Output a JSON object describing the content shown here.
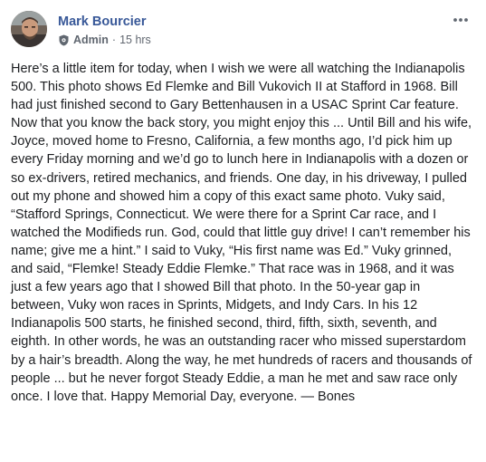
{
  "post": {
    "author_name": "Mark Bourcier",
    "role_label": "Admin",
    "separator": "·",
    "timestamp": "15 hrs",
    "body": "Here’s a little item for today, when I wish we were all watching the Indianapolis 500. This photo shows Ed Flemke and Bill Vukovich II at Stafford in 1968. Bill had just finished second to Gary Bettenhausen in a USAC Sprint Car feature. Now that you know the back story, you might enjoy this ... Until Bill and his wife, Joyce, moved home to Fresno, California, a few months ago, I’d pick him up every Friday morning and we’d go to lunch here in Indianapolis with a dozen or so ex-drivers, retired mechanics, and friends. One day, in his driveway, I pulled out my phone and showed him a copy of this exact same photo. Vuky said, “Stafford Springs, Connecticut. We were there for a Sprint Car race, and I watched the Modifieds run. God, could that little guy drive! I can’t remember his name; give me a hint.” I said to Vuky, “His first name was Ed.” Vuky grinned, and said, “Flemke! Steady Eddie Flemke.” That race was in 1968, and it was just a few years ago that I showed Bill that photo. In the 50-year gap in between, Vuky won races in Sprints, Midgets, and Indy Cars. In his 12 Indianapolis 500 starts, he finished second, third, fifth, sixth, seventh, and eighth. In other words, he was an outstanding racer who missed superstardom by a hair’s breadth. Along the way, he met hundreds of racers and thousands of people ... but he never forgot Steady Eddie, a man he met and saw race only once. I love that. Happy Memorial Day, everyone. — Bones"
  },
  "icons": {
    "avatar": "profile-photo",
    "admin": "shield-gear-icon",
    "more": "more-options-icon"
  },
  "colors": {
    "author_link": "#385898",
    "body_text": "#1c1e21",
    "meta_text": "#616770",
    "background": "#ffffff"
  }
}
